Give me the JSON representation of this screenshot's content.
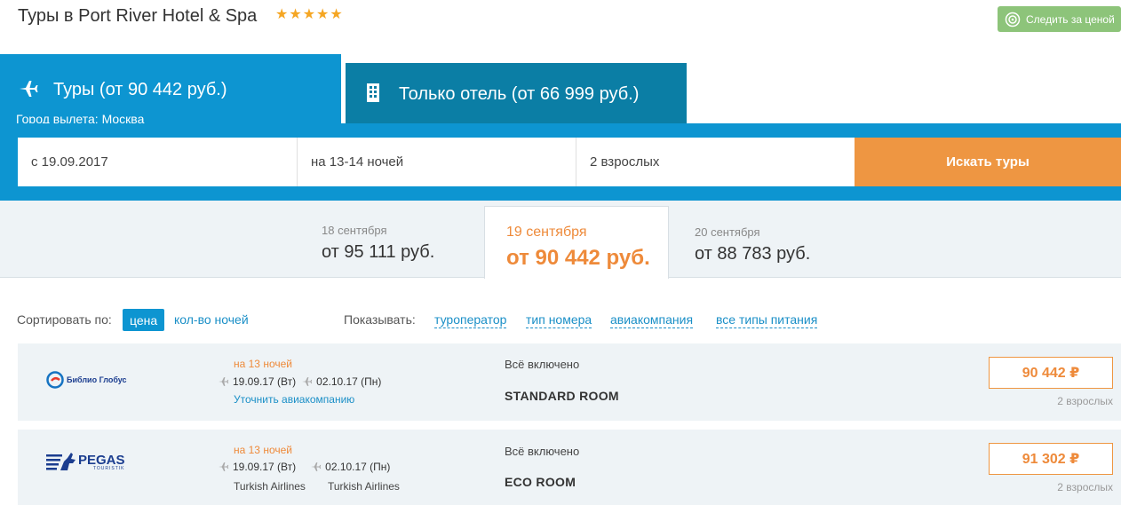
{
  "header": {
    "title": "Туры в Port River Hotel & Spa",
    "stars": "★★★★★",
    "watch_label": "Следить за ценой"
  },
  "tabs": {
    "tours": {
      "label": "Туры (от 90 442 руб.)",
      "city_label": "Город вылета:",
      "city": "Москва"
    },
    "hotel": {
      "label": "Только отель (от 66 999 руб.)"
    }
  },
  "search": {
    "date": "с 19.09.2017",
    "nights": "на 13-14 ночей",
    "guests": "2 взрослых",
    "button": "Искать туры"
  },
  "dates": [
    {
      "date": "18 сентября",
      "price": "от 95 111 руб."
    },
    {
      "date": "19 сентября",
      "price": "от 90 442 руб."
    },
    {
      "date": "20 сентября",
      "price": "от 88 783 руб."
    }
  ],
  "sort": {
    "label": "Сортировать по:",
    "active": "цена",
    "nights": "кол-во ночей",
    "show_label": "Показывать:",
    "filters": [
      "туроператор",
      "тип номера",
      "авиакомпания",
      "все типы питания"
    ]
  },
  "results": [
    {
      "operator": "Библио Глобус",
      "nights": "на 13 ночей",
      "out_date": "19.09.17 (Вт)",
      "back_date": "02.10.17 (Пн)",
      "airline_link": "Уточнить авиакомпанию",
      "meal": "Всё включено",
      "room": "STANDARD ROOM",
      "price": "90 442 ₽",
      "adults": "2 взрослых"
    },
    {
      "operator": "PEGAS",
      "operator_sub": "TOURISTIK",
      "nights": "на 13 ночей",
      "out_date": "19.09.17 (Вт)",
      "back_date": "02.10.17 (Пн)",
      "airline_out": "Turkish Airlines",
      "airline_back": "Turkish Airlines",
      "meal": "Всё включено",
      "room": "ECO ROOM",
      "price": "91 302 ₽",
      "adults": "2 взрослых"
    }
  ],
  "colors": {
    "brand_blue": "#0d95d1",
    "hotel_tab": "#0b7ea5",
    "orange": "#ee9642",
    "green": "#8dc47a"
  }
}
